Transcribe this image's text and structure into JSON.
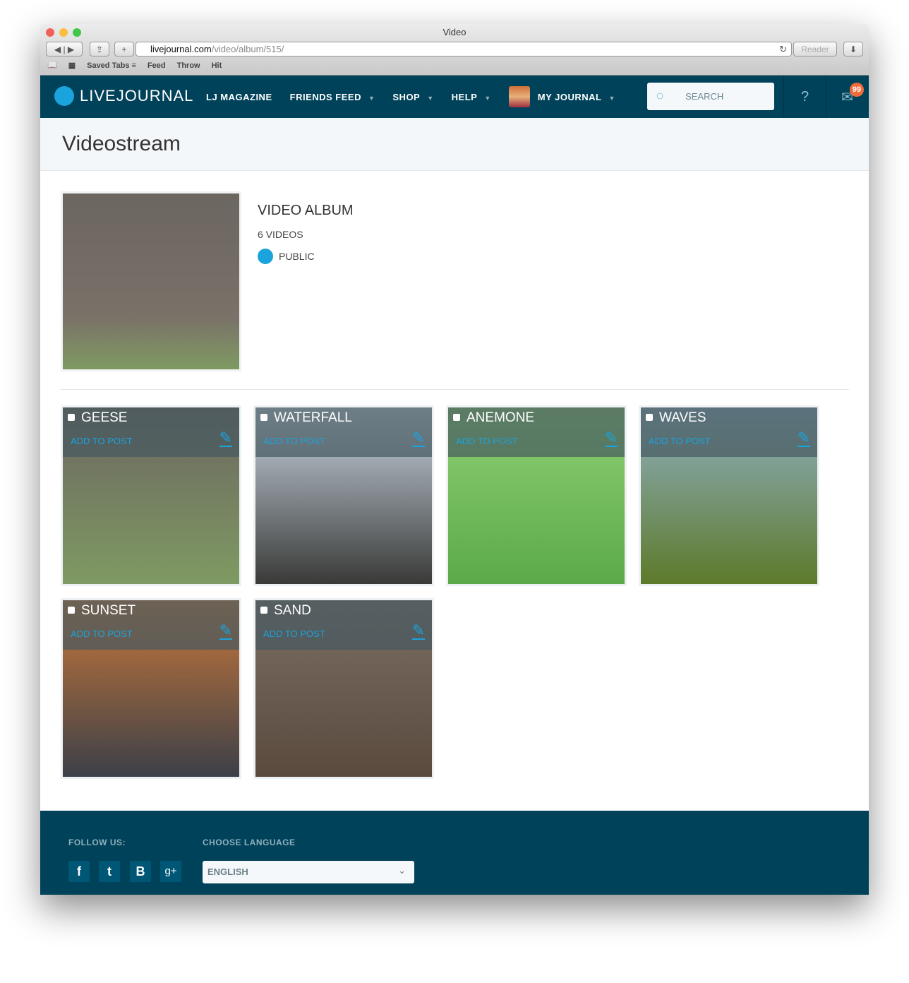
{
  "browser": {
    "title": "Video",
    "url_host": "livejournal.com",
    "url_path": "/video/album/515/",
    "reader": "Reader",
    "bookmarks": [
      "Saved Tabs ≡",
      "Feed",
      "Throw",
      "Hit"
    ]
  },
  "nav": {
    "logo": "LIVEJOURNAL",
    "items": [
      {
        "label": "LJ MAGAZINE",
        "caret": false
      },
      {
        "label": "FRIENDS FEED",
        "caret": true
      },
      {
        "label": "SHOP",
        "caret": true
      },
      {
        "label": "HELP",
        "caret": true
      }
    ],
    "my_journal": "MY JOURNAL",
    "search_placeholder": "SEARCH",
    "messages_count": "99"
  },
  "page": {
    "title": "Videostream"
  },
  "album": {
    "title": "VIDEO ALBUM",
    "count": "6 VIDEOS",
    "privacy": "PUBLIC"
  },
  "videos": [
    {
      "name": "GEESE",
      "action": "ADD TO POST",
      "colors": [
        "#6b6660",
        "#7f9a62"
      ]
    },
    {
      "name": "WATERFALL",
      "action": "ADD TO POST",
      "colors": [
        "#c9d6e2",
        "#3a3a38"
      ]
    },
    {
      "name": "ANEMONE",
      "action": "ADD TO POST",
      "colors": [
        "#8fcf74",
        "#5aaa4a"
      ]
    },
    {
      "name": "WAVES",
      "action": "ADD TO POST",
      "colors": [
        "#8fb0c2",
        "#5d7a2a"
      ]
    },
    {
      "name": "SUNSET",
      "action": "ADD TO POST",
      "colors": [
        "#c8773a",
        "#3c4048"
      ]
    },
    {
      "name": "SAND",
      "action": "ADD TO POST",
      "colors": [
        "#7a6e64",
        "#5a4a3e"
      ]
    }
  ],
  "footer": {
    "follow": "FOLLOW US:",
    "social": [
      "f",
      "t",
      "B",
      "g+"
    ],
    "language_label": "CHOOSE LANGUAGE",
    "language": "ENGLISH"
  }
}
